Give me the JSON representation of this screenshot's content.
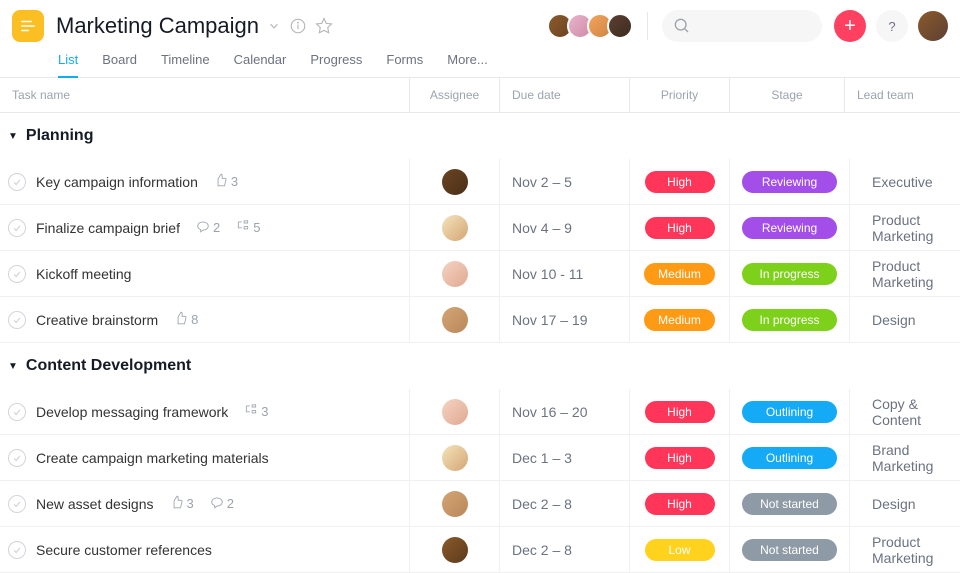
{
  "project": {
    "title": "Marketing Campaign"
  },
  "tabs": [
    "List",
    "Board",
    "Timeline",
    "Calendar",
    "Progress",
    "Forms",
    "More..."
  ],
  "activeTab": 0,
  "cols": {
    "task": "Task name",
    "assignee": "Assignee",
    "due": "Due date",
    "priority": "Priority",
    "stage": "Stage",
    "team": "Lead team"
  },
  "priorityColors": {
    "High": "#ff3559",
    "Medium": "#ff9a14",
    "Low": "#ffd21e"
  },
  "stageColors": {
    "Reviewing": "#a44eea",
    "In progress": "#7dd11a",
    "Outlining": "#14aaf5",
    "Not started": "#8e9aa5"
  },
  "sections": [
    {
      "title": "Planning",
      "tasks": [
        {
          "name": "Key campaign information",
          "likes": 3,
          "comments": null,
          "subtasks": null,
          "assignee": "sa1",
          "due": "Nov 2 – 5",
          "priority": "High",
          "stage": "Reviewing",
          "team": "Executive"
        },
        {
          "name": "Finalize campaign brief",
          "likes": null,
          "comments": 2,
          "subtasks": 5,
          "assignee": "sa2",
          "due": "Nov 4 – 9",
          "priority": "High",
          "stage": "Reviewing",
          "team": "Product Marketing"
        },
        {
          "name": "Kickoff meeting",
          "likes": null,
          "comments": null,
          "subtasks": null,
          "assignee": "sa3",
          "due": "Nov 10 - 11",
          "priority": "Medium",
          "stage": "In progress",
          "team": "Product Marketing"
        },
        {
          "name": "Creative brainstorm",
          "likes": 8,
          "comments": null,
          "subtasks": null,
          "assignee": "sa4",
          "due": "Nov 17 – 19",
          "priority": "Medium",
          "stage": "In progress",
          "team": "Design"
        }
      ]
    },
    {
      "title": "Content Development",
      "tasks": [
        {
          "name": "Develop messaging framework",
          "likes": null,
          "comments": null,
          "subtasks": 3,
          "assignee": "sa3",
          "due": "Nov 16 – 20",
          "priority": "High",
          "stage": "Outlining",
          "team": "Copy & Content"
        },
        {
          "name": "Create campaign marketing materials",
          "likes": null,
          "comments": null,
          "subtasks": null,
          "assignee": "sa2",
          "due": "Dec 1 – 3",
          "priority": "High",
          "stage": "Outlining",
          "team": "Brand Marketing"
        },
        {
          "name": "New asset designs",
          "likes": 3,
          "comments": 2,
          "subtasks": null,
          "assignee": "sa4",
          "due": "Dec 2 – 8",
          "priority": "High",
          "stage": "Not started",
          "team": "Design"
        },
        {
          "name": "Secure customer references",
          "likes": null,
          "comments": null,
          "subtasks": null,
          "assignee": "sa5",
          "due": "Dec 2 – 8",
          "priority": "Low",
          "stage": "Not started",
          "team": "Product Marketing"
        }
      ]
    }
  ]
}
